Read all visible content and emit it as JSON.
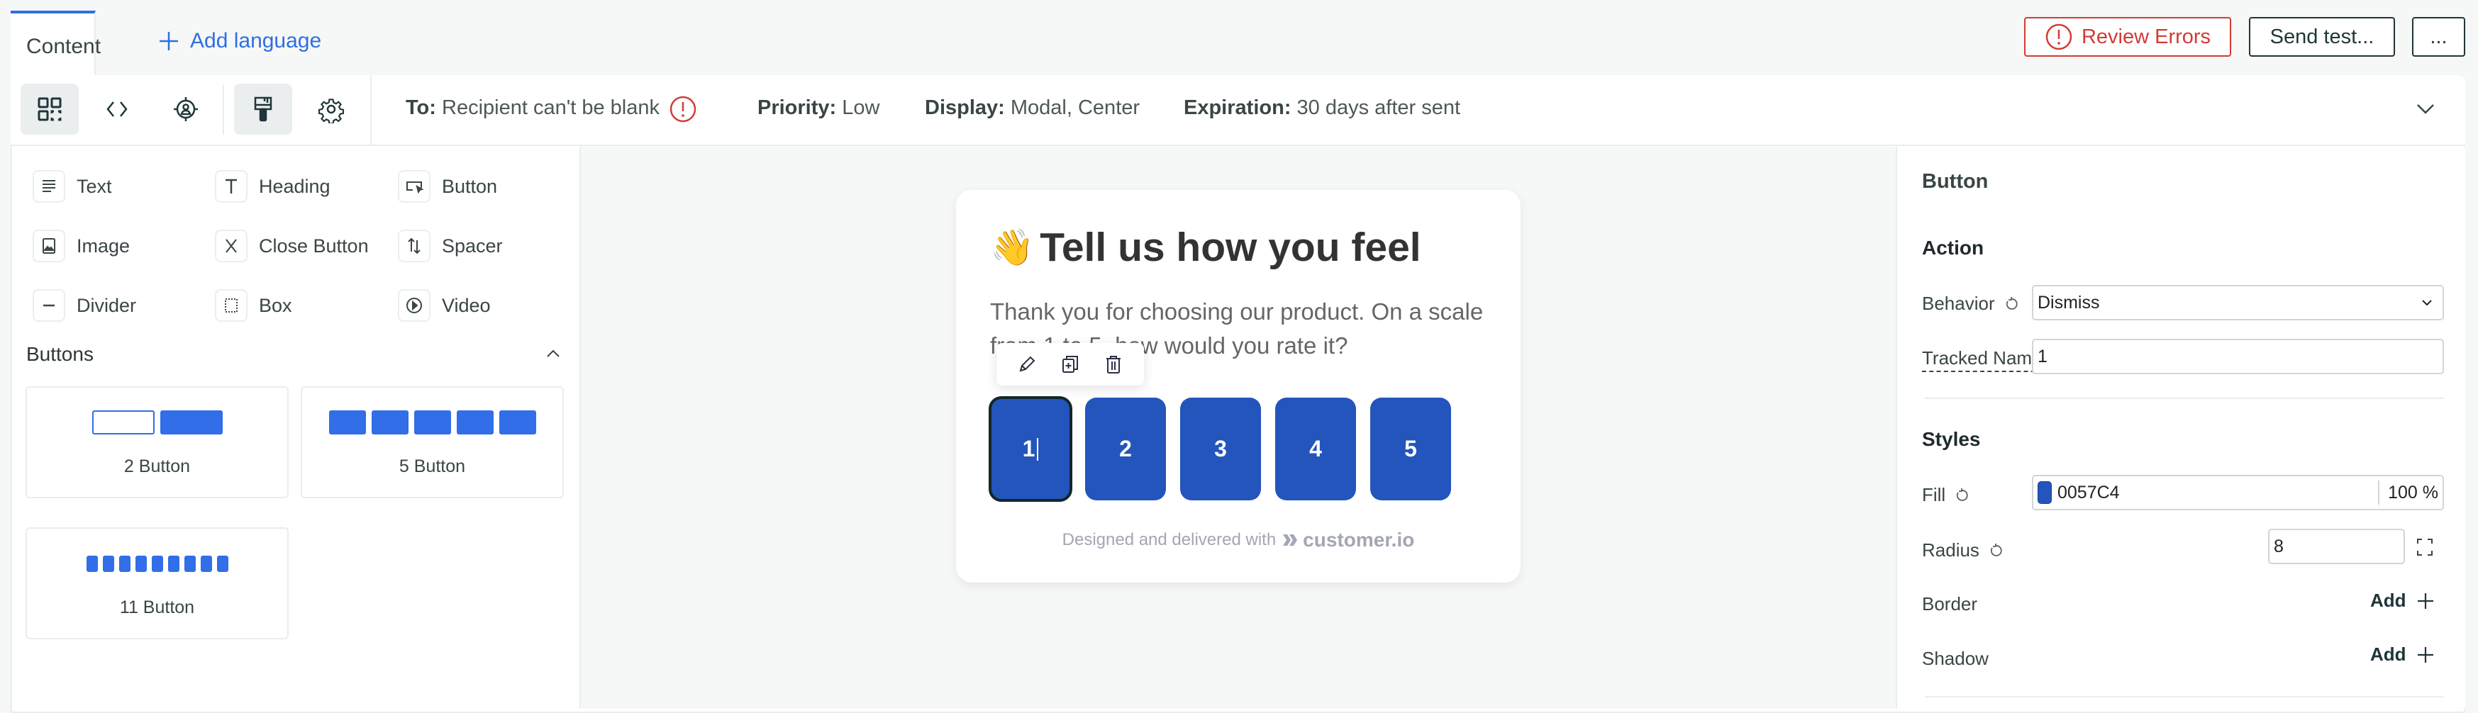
{
  "tabs": {
    "content": "Content",
    "add_language": "Add language"
  },
  "actions": {
    "review_errors": "Review Errors",
    "send_test": "Send test...",
    "more": "..."
  },
  "toolbar": {
    "icons": [
      "blocks-grid-icon",
      "code-icon",
      "targeting-icon",
      "paintbrush-icon",
      "gear-icon"
    ],
    "active": [
      "blocks-grid-icon",
      "paintbrush-icon"
    ]
  },
  "meta": {
    "to_label": "To:",
    "to_value": "Recipient can't be blank",
    "priority_label": "Priority:",
    "priority_value": "Low",
    "display_label": "Display:",
    "display_value": "Modal, Center",
    "expiration_label": "Expiration:",
    "expiration_value": "30 days after sent"
  },
  "blocks": [
    {
      "label": "Text",
      "icon": "text-lines-icon"
    },
    {
      "label": "Heading",
      "icon": "heading-t-icon"
    },
    {
      "label": "Button",
      "icon": "button-cursor-icon"
    },
    {
      "label": "Image",
      "icon": "image-icon"
    },
    {
      "label": "Close Button",
      "icon": "close-x-icon"
    },
    {
      "label": "Spacer",
      "icon": "spacer-arrows-icon"
    },
    {
      "label": "Divider",
      "icon": "divider-line-icon"
    },
    {
      "label": "Box",
      "icon": "box-dotted-icon"
    },
    {
      "label": "Video",
      "icon": "play-circle-icon"
    }
  ],
  "buttons_section": {
    "title": "Buttons",
    "presets": [
      {
        "label": "2 Button"
      },
      {
        "label": "5 Button"
      },
      {
        "label": "11 Button"
      }
    ]
  },
  "modal": {
    "emoji": "👋",
    "title": "Tell us how you feel",
    "body": "Thank you for choosing our product. On a scale from 1 to 5, how would you rate it?",
    "ratings": [
      "1",
      "2",
      "3",
      "4",
      "5"
    ],
    "selected_rating": "1",
    "footer_text": "Designed and delivered with",
    "footer_brand": "customer.io",
    "float_toolbar": [
      "edit-pencil-icon",
      "duplicate-icon",
      "trash-icon"
    ]
  },
  "properties": {
    "title": "Button",
    "action_section": "Action",
    "behavior_label": "Behavior",
    "behavior_value": "Dismiss",
    "tracked_name_label": "Tracked Name",
    "tracked_name_value": "1",
    "styles_section": "Styles",
    "fill_label": "Fill",
    "fill_value": "0057C4",
    "fill_opacity": "100 %",
    "fill_swatch_color": "#2355bc",
    "radius_label": "Radius",
    "radius_value": "8",
    "border_label": "Border",
    "border_action": "Add",
    "shadow_label": "Shadow",
    "shadow_action": "Add"
  },
  "colors": {
    "accent": "#2f6fe0",
    "error": "#d23b34",
    "rating_button": "#2355bc",
    "preset_blue": "#316ee8"
  }
}
